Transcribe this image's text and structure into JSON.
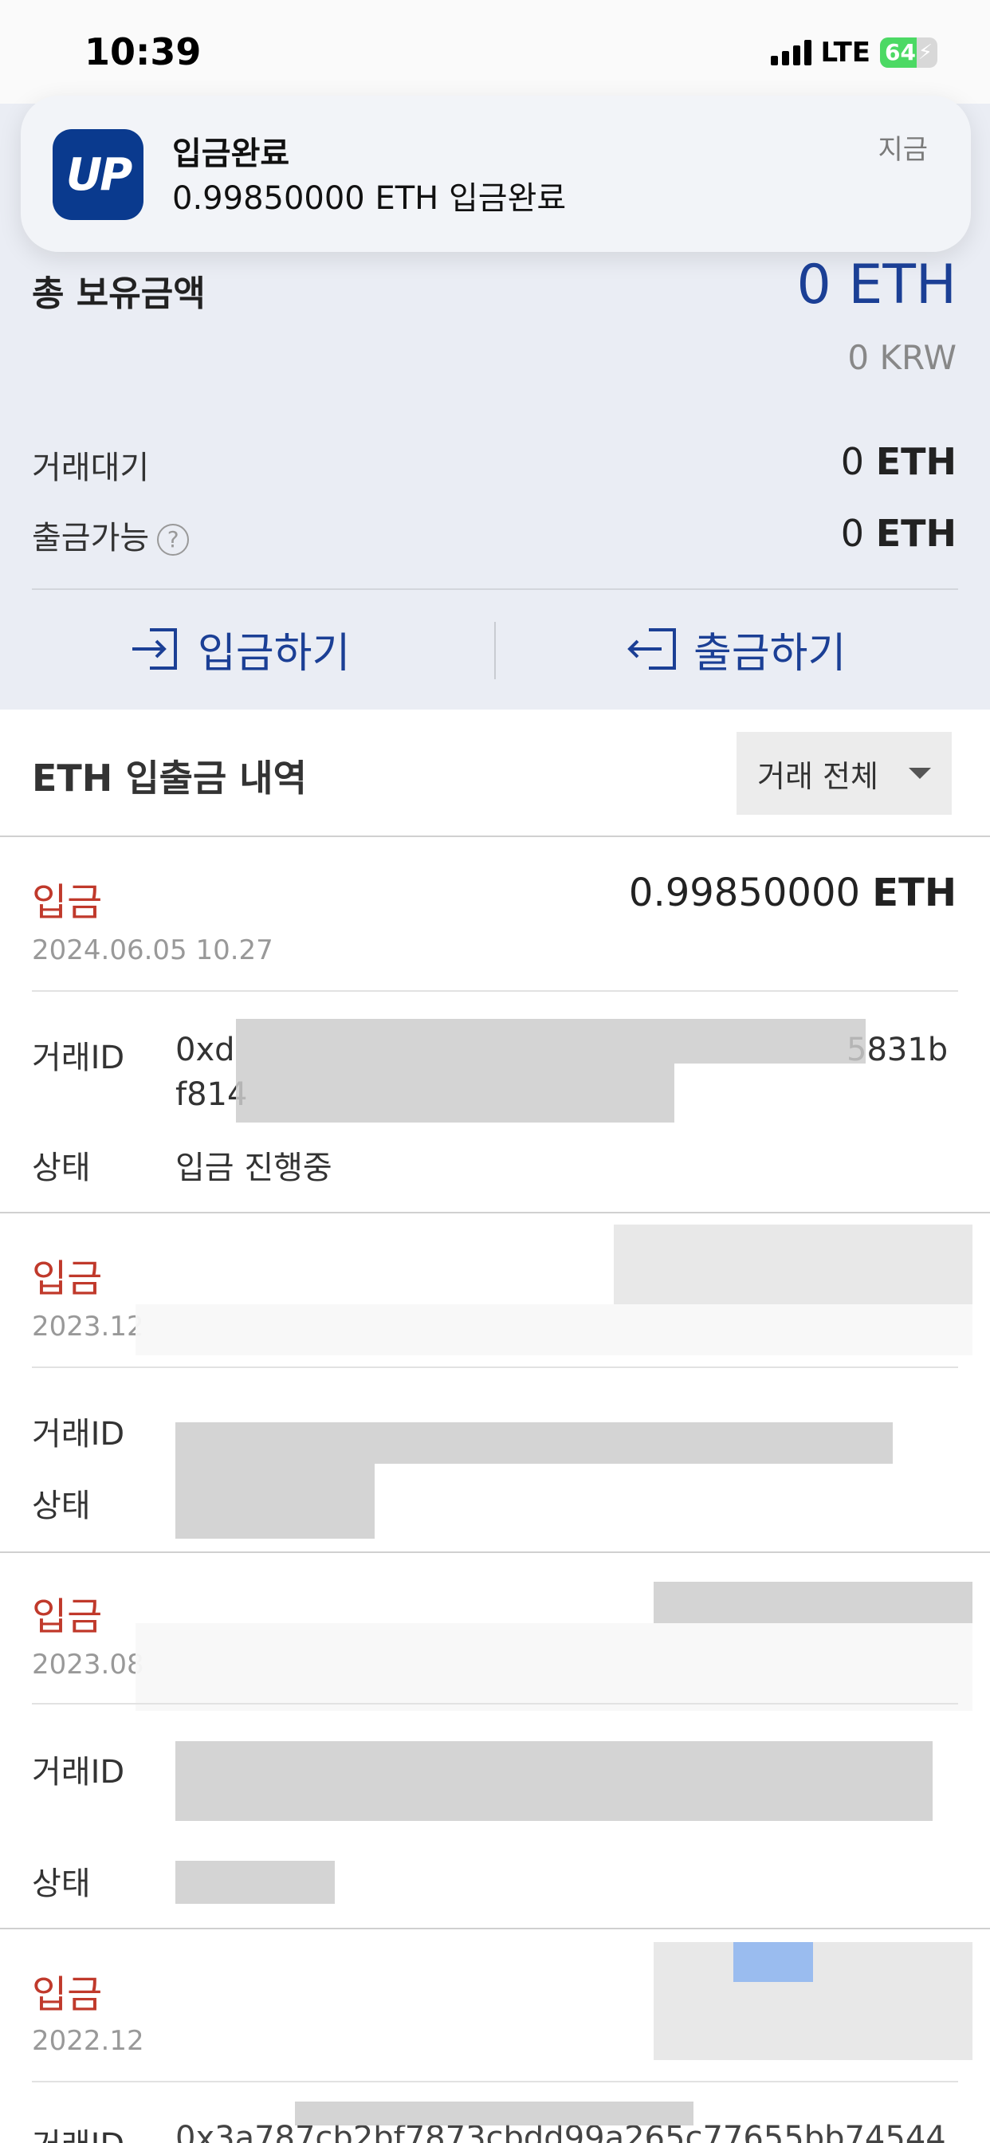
{
  "status_bar": {
    "time": "10:39",
    "network": "LTE",
    "battery": "64",
    "battery_level": 0.64
  },
  "notification": {
    "app_icon_text": "UP",
    "title": "입금완료",
    "body": "0.99850000 ETH 입금완료",
    "time": "지금"
  },
  "summary": {
    "total_label": "총 보유금액",
    "total_eth": "0 ETH",
    "total_krw": "0 KRW",
    "pending_label": "거래대기",
    "pending_value": "0",
    "withdrawable_label": "출금가능",
    "withdrawable_value": "0",
    "unit": "ETH",
    "help_icon": "?"
  },
  "actions": {
    "deposit_label": "입금하기",
    "withdraw_label": "출금하기"
  },
  "history": {
    "title": "ETH 입출금 내역",
    "filter_label": "거래 전체",
    "id_label": "거래ID",
    "status_label": "상태",
    "items": [
      {
        "type": "입금",
        "date": "2024.06.05 10.27",
        "amount": "0.99850000",
        "unit": "ETH",
        "tx_id_visible": "0xd",
        "tx_id_tail": "5831b",
        "tx_id_line2": "f814",
        "status": "입금 진행중"
      },
      {
        "type": "입금",
        "date": "2023.12"
      },
      {
        "type": "입금",
        "date": "2023.08"
      },
      {
        "type": "입금",
        "date": "2022.12",
        "tx_id_visible": "0x3a787cb2bf7873cbdd99a265c77655bb74544"
      }
    ]
  },
  "colors": {
    "accent": "#1b3f95",
    "deposit": "#c0392b",
    "summary_bg": "#eaedf4"
  }
}
